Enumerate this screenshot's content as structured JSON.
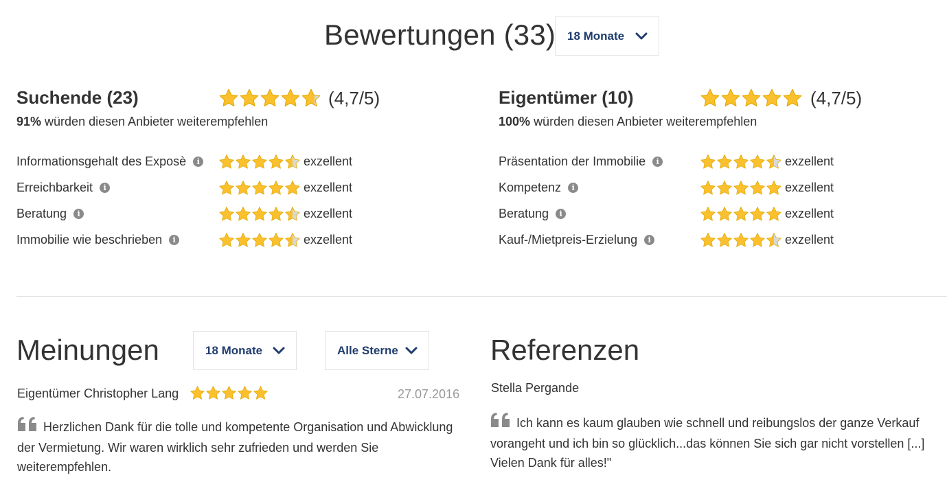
{
  "header": {
    "title": "Bewertungen (33)",
    "period_dropdown": "18 Monate"
  },
  "seekers": {
    "title": "Suchende (23)",
    "rating": 4.7,
    "score_text": "(4,7/5)",
    "recommend_percent": "91%",
    "recommend_text": "würden diesen Anbieter weiterempfehlen",
    "criteria": [
      {
        "label": "Informationsgehalt des Exposè",
        "rating": 4.5,
        "value": "exzellent"
      },
      {
        "label": "Erreichbarkeit",
        "rating": 5,
        "value": "exzellent"
      },
      {
        "label": "Beratung",
        "rating": 4.5,
        "value": "exzellent"
      },
      {
        "label": "Immobilie wie beschrieben",
        "rating": 4.5,
        "value": "exzellent"
      }
    ]
  },
  "owners": {
    "title": "Eigentümer (10)",
    "rating": 5,
    "score_text": "(4,7/5)",
    "recommend_percent": "100%",
    "recommend_text": "würden diesen Anbieter weiterempfehlen",
    "criteria": [
      {
        "label": "Präsentation der Immobilie",
        "rating": 4.5,
        "value": "exzellent"
      },
      {
        "label": "Kompetenz",
        "rating": 5,
        "value": "exzellent"
      },
      {
        "label": "Beratung",
        "rating": 5,
        "value": "exzellent"
      },
      {
        "label": "Kauf-/Mietpreis-Erzielung",
        "rating": 4.5,
        "value": "exzellent"
      }
    ]
  },
  "opinions": {
    "title": "Meinungen",
    "period_dropdown": "18 Monate",
    "stars_dropdown": "Alle Sterne",
    "review": {
      "author": "Eigentümer Christopher Lang",
      "rating": 5,
      "date": "27.07.2016",
      "text": "Herzlichen Dank für die tolle und kompetente Organisation und Abwicklung der Vermietung. Wir waren wirklich sehr zufrieden und werden Sie weiterempfehlen."
    }
  },
  "references": {
    "title": "Referenzen",
    "author": "Stella Pergande",
    "text": "Ich kann es kaum glauben wie schnell und reibungslos der ganze Verkauf vorangeht und ich bin so glücklich...das können Sie sich gar nicht vorstellen [...] Vielen Dank für alles!\""
  },
  "colors": {
    "star_fill": "#fbc02d",
    "star_stroke": "#e0a800",
    "star_empty": "#d9d9d9",
    "dropdown_text": "#1f3d6e",
    "quote_icon": "#8a8a8a"
  }
}
